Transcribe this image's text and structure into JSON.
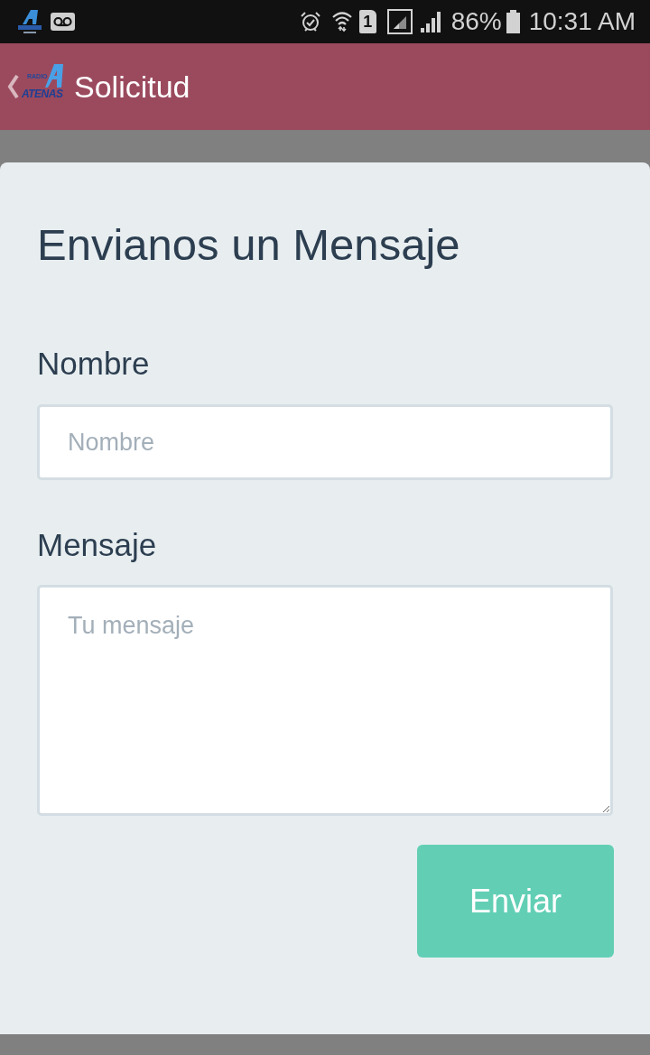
{
  "status_bar": {
    "sim_slot": "1",
    "battery": "86%",
    "time": "10:31 AM"
  },
  "header": {
    "logo": {
      "line_1": "RADIO",
      "line_2": "ATENAS"
    },
    "title": "Solicitud"
  },
  "form": {
    "title": "Envianos un Mensaje",
    "fields": [
      {
        "kind": "input",
        "label": "Nombre",
        "placeholder": "Nombre"
      },
      {
        "kind": "textarea",
        "label": "Mensaje",
        "placeholder": "Tu mensaje"
      }
    ],
    "submit": "Enviar"
  }
}
